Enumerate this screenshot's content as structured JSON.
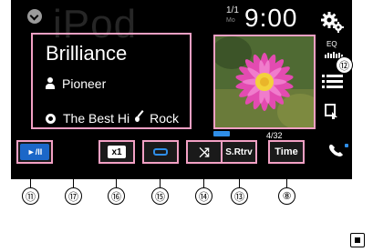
{
  "screen": {
    "source_watermark": "iPod",
    "clock": "9:00",
    "track_counter": "1/1",
    "track_counter_sub": "Mo",
    "track_number_small": "4/32"
  },
  "track": {
    "title": "Brilliance",
    "artist": "Pioneer",
    "album": "The Best Hi",
    "genre": "Rock"
  },
  "side_menu": {
    "eq_label": "EQ"
  },
  "controls": {
    "play_pause": "►/II",
    "speed": "x1",
    "shuffle": "⤨",
    "sound_retriever": "S.Rtrv",
    "time_display": "Time"
  },
  "callouts": {
    "c11": "⑪",
    "c17": "⑰",
    "c16": "⑯",
    "c15": "⑮",
    "c14": "⑭",
    "c13": "⑬",
    "c8": "⑧",
    "c12": "⑫"
  },
  "colors": {
    "callout_border": "#f2a0c4",
    "accent_blue": "#1c67c8",
    "screen_bg": "#000000"
  }
}
